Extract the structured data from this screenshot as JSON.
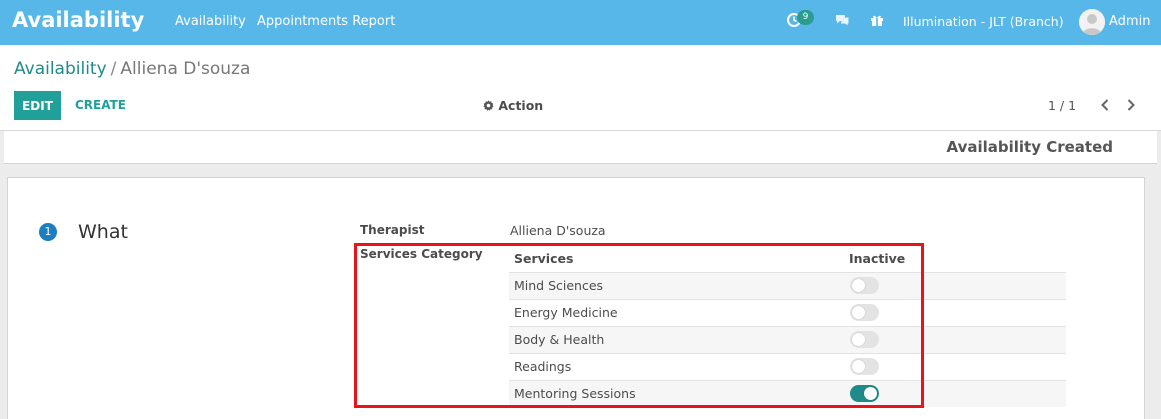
{
  "navbar": {
    "brand": "Availability",
    "menu": [
      "Availability",
      "Appointments Report"
    ],
    "notification_count": "9",
    "company": "Illumination - JLT (Branch)",
    "user": "Admin"
  },
  "breadcrumb": {
    "parent": "Availability",
    "separator": "/",
    "current": "Alliena D'souza"
  },
  "toolbar": {
    "edit_label": "EDIT",
    "create_label": "CREATE",
    "action_label": "Action",
    "pager": "1 / 1"
  },
  "status": {
    "title": "Availability Created"
  },
  "form": {
    "step_number": "1",
    "step_title": "What",
    "therapist_label": "Therapist",
    "therapist_value": "Alliena D'souza",
    "services_category_label": "Services Category",
    "table": {
      "headers": [
        "Services",
        "Inactive"
      ],
      "rows": [
        {
          "service": "Mind Sciences",
          "inactive": false
        },
        {
          "service": "Energy Medicine",
          "inactive": false
        },
        {
          "service": "Body & Health",
          "inactive": false
        },
        {
          "service": "Readings",
          "inactive": false
        },
        {
          "service": "Mentoring Sessions",
          "inactive": true
        }
      ]
    }
  },
  "colors": {
    "navbar": "#57b7e8",
    "accent": "#21a09a",
    "toggle_on": "#1f8a8a",
    "highlight": "#e8141b",
    "step_circle": "#1e7dbf"
  },
  "icons": {
    "activity": "activity-clock-icon",
    "chat": "chat-bubble-icon",
    "gift": "gift-icon",
    "action": "gear-icon",
    "prev": "chevron-left-icon",
    "next": "chevron-right-icon"
  }
}
